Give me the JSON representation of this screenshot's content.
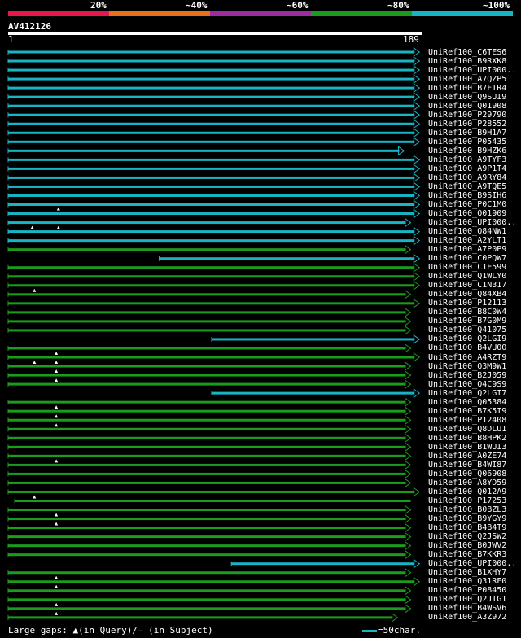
{
  "legend": {
    "labels": [
      "20%",
      "~40%",
      "~60%",
      "~80%",
      "~100%"
    ],
    "colors": [
      "#e8174c",
      "#e8701c",
      "#9c2ca0",
      "#1c9c1c",
      "#18b4c4"
    ]
  },
  "query": {
    "name": "AV412126",
    "start": "1",
    "end": "189"
  },
  "hits": [
    {
      "name": "UniRef100_C6TES6",
      "color": "#18b4c4",
      "start": 1,
      "end": 189,
      "arrow": true,
      "marks": []
    },
    {
      "name": "UniRef100_B9RXK8",
      "color": "#18b4c4",
      "start": 1,
      "end": 189,
      "arrow": true,
      "marks": []
    },
    {
      "name": "UniRef100_UPI000..",
      "color": "#18b4c4",
      "start": 1,
      "end": 189,
      "arrow": true,
      "marks": []
    },
    {
      "name": "UniRef100_A7QZP5",
      "color": "#18b4c4",
      "start": 1,
      "end": 189,
      "arrow": true,
      "marks": []
    },
    {
      "name": "UniRef100_B7FIR4",
      "color": "#18b4c4",
      "start": 1,
      "end": 189,
      "arrow": true,
      "marks": []
    },
    {
      "name": "UniRef100_Q9SUI9",
      "color": "#18b4c4",
      "start": 1,
      "end": 189,
      "arrow": true,
      "marks": []
    },
    {
      "name": "UniRef100_Q01908",
      "color": "#18b4c4",
      "start": 1,
      "end": 189,
      "arrow": true,
      "marks": []
    },
    {
      "name": "UniRef100_P29790",
      "color": "#18b4c4",
      "start": 1,
      "end": 189,
      "arrow": true,
      "marks": []
    },
    {
      "name": "UniRef100_P28552",
      "color": "#18b4c4",
      "start": 1,
      "end": 189,
      "arrow": true,
      "marks": []
    },
    {
      "name": "UniRef100_B9H1A7",
      "color": "#18b4c4",
      "start": 1,
      "end": 189,
      "arrow": true,
      "marks": []
    },
    {
      "name": "UniRef100_P05435",
      "color": "#18b4c4",
      "start": 1,
      "end": 189,
      "arrow": true,
      "marks": []
    },
    {
      "name": "UniRef100_B9HZK6",
      "color": "#18b4c4",
      "start": 1,
      "end": 182,
      "arrow": true,
      "marks": []
    },
    {
      "name": "UniRef100_A9TYF3",
      "color": "#18b4c4",
      "start": 1,
      "end": 189,
      "arrow": true,
      "marks": []
    },
    {
      "name": "UniRef100_A9P1T4",
      "color": "#18b4c4",
      "start": 1,
      "end": 189,
      "arrow": true,
      "marks": []
    },
    {
      "name": "UniRef100_A9RY84",
      "color": "#18b4c4",
      "start": 1,
      "end": 189,
      "arrow": true,
      "marks": []
    },
    {
      "name": "UniRef100_A9TQE5",
      "color": "#18b4c4",
      "start": 1,
      "end": 189,
      "arrow": true,
      "marks": []
    },
    {
      "name": "UniRef100_B9SIH6",
      "color": "#18b4c4",
      "start": 1,
      "end": 189,
      "arrow": true,
      "marks": []
    },
    {
      "name": "UniRef100_P0C1M0",
      "color": "#18b4c4",
      "start": 1,
      "end": 189,
      "arrow": true,
      "marks": []
    },
    {
      "name": "UniRef100_Q01909",
      "color": "#18b4c4",
      "start": 1,
      "end": 189,
      "arrow": true,
      "marks": [
        {
          "pos": 24,
          "row": "above"
        }
      ]
    },
    {
      "name": "UniRef100_UPI000..",
      "color": "#18b4c4",
      "start": 1,
      "end": 185,
      "arrow": true,
      "marks": [
        {
          "pos": 12,
          "row": "below"
        },
        {
          "pos": 24,
          "row": "below"
        }
      ]
    },
    {
      "name": "UniRef100_Q84NW1",
      "color": "#18b4c4",
      "start": 1,
      "end": 189,
      "arrow": true,
      "marks": []
    },
    {
      "name": "UniRef100_A2YLT1",
      "color": "#18b4c4",
      "start": 1,
      "end": 189,
      "arrow": true,
      "marks": []
    },
    {
      "name": "UniRef100_A7P0P9",
      "color": "#1c9c1c",
      "start": 1,
      "end": 185,
      "arrow": true,
      "marks": []
    },
    {
      "name": "UniRef100_C0PQW7",
      "color": "#18b4c4",
      "start": 70,
      "end": 189,
      "arrow": true,
      "marks": []
    },
    {
      "name": "UniRef100_C1E599",
      "color": "#1c9c1c",
      "start": 1,
      "end": 189,
      "arrow": true,
      "marks": []
    },
    {
      "name": "UniRef100_Q1WLY0",
      "color": "#1c9c1c",
      "start": 1,
      "end": 189,
      "arrow": true,
      "marks": []
    },
    {
      "name": "UniRef100_C1N317",
      "color": "#1c9c1c",
      "start": 1,
      "end": 189,
      "arrow": true,
      "marks": [
        {
          "pos": 13,
          "row": "below"
        }
      ]
    },
    {
      "name": "UniRef100_Q84XB4",
      "color": "#1c9c1c",
      "start": 1,
      "end": 185,
      "arrow": true,
      "marks": []
    },
    {
      "name": "UniRef100_P12113",
      "color": "#1c9c1c",
      "start": 1,
      "end": 189,
      "arrow": true,
      "marks": []
    },
    {
      "name": "UniRef100_B8C0W4",
      "color": "#1c9c1c",
      "start": 1,
      "end": 185,
      "arrow": true,
      "marks": []
    },
    {
      "name": "UniRef100_B7G0M9",
      "color": "#1c9c1c",
      "start": 1,
      "end": 185,
      "arrow": true,
      "marks": []
    },
    {
      "name": "UniRef100_Q41075",
      "color": "#1c9c1c",
      "start": 1,
      "end": 185,
      "arrow": true,
      "marks": []
    },
    {
      "name": "UniRef100_Q2LGI9",
      "color": "#18b4c4",
      "start": 94,
      "end": 189,
      "arrow": true,
      "marks": []
    },
    {
      "name": "UniRef100_B4VU00",
      "color": "#1c9c1c",
      "start": 1,
      "end": 185,
      "arrow": true,
      "marks": [
        {
          "pos": 23,
          "row": "below"
        }
      ]
    },
    {
      "name": "UniRef100_A4RZT9",
      "color": "#1c9c1c",
      "start": 1,
      "end": 189,
      "arrow": true,
      "marks": [
        {
          "pos": 13,
          "row": "below"
        },
        {
          "pos": 23,
          "row": "below"
        }
      ]
    },
    {
      "name": "UniRef100_Q3M9W1",
      "color": "#1c9c1c",
      "start": 1,
      "end": 185,
      "arrow": true,
      "marks": [
        {
          "pos": 23,
          "row": "below"
        }
      ]
    },
    {
      "name": "UniRef100_B2J059",
      "color": "#1c9c1c",
      "start": 1,
      "end": 185,
      "arrow": true,
      "marks": [
        {
          "pos": 23,
          "row": "below"
        }
      ]
    },
    {
      "name": "UniRef100_Q4C9S9",
      "color": "#1c9c1c",
      "start": 1,
      "end": 185,
      "arrow": true,
      "marks": []
    },
    {
      "name": "UniRef100_Q2LGI7",
      "color": "#18b4c4",
      "start": 94,
      "end": 189,
      "arrow": true,
      "marks": []
    },
    {
      "name": "UniRef100_Q05384",
      "color": "#1c9c1c",
      "start": 1,
      "end": 185,
      "arrow": true,
      "marks": [
        {
          "pos": 23,
          "row": "below"
        }
      ]
    },
    {
      "name": "UniRef100_B7K5I9",
      "color": "#1c9c1c",
      "start": 1,
      "end": 185,
      "arrow": true,
      "marks": [
        {
          "pos": 23,
          "row": "below"
        }
      ]
    },
    {
      "name": "UniRef100_P12408",
      "color": "#1c9c1c",
      "start": 1,
      "end": 185,
      "arrow": true,
      "marks": [
        {
          "pos": 23,
          "row": "below"
        }
      ]
    },
    {
      "name": "UniRef100_Q8DLU1",
      "color": "#1c9c1c",
      "start": 1,
      "end": 185,
      "arrow": true,
      "marks": []
    },
    {
      "name": "UniRef100_B8HPK2",
      "color": "#1c9c1c",
      "start": 1,
      "end": 185,
      "arrow": true,
      "marks": []
    },
    {
      "name": "UniRef100_B1WUI3",
      "color": "#1c9c1c",
      "start": 1,
      "end": 185,
      "arrow": true,
      "marks": []
    },
    {
      "name": "UniRef100_A0ZE74",
      "color": "#1c9c1c",
      "start": 1,
      "end": 185,
      "arrow": true,
      "marks": [
        {
          "pos": 23,
          "row": "below"
        }
      ]
    },
    {
      "name": "UniRef100_B4WI87",
      "color": "#1c9c1c",
      "start": 1,
      "end": 185,
      "arrow": true,
      "marks": []
    },
    {
      "name": "UniRef100_Q06908",
      "color": "#1c9c1c",
      "start": 1,
      "end": 185,
      "arrow": true,
      "marks": []
    },
    {
      "name": "UniRef100_A8YD59",
      "color": "#1c9c1c",
      "start": 1,
      "end": 185,
      "arrow": true,
      "marks": []
    },
    {
      "name": "UniRef100_Q012A9",
      "color": "#1c9c1c",
      "start": 1,
      "end": 189,
      "arrow": true,
      "marks": [
        {
          "pos": 13,
          "row": "below"
        }
      ]
    },
    {
      "name": "UniRef100_P17253",
      "color": "#1c9c1c",
      "start": 4,
      "end": 185,
      "arrow": false,
      "marks": []
    },
    {
      "name": "UniRef100_B0BZL3",
      "color": "#1c9c1c",
      "start": 1,
      "end": 185,
      "arrow": true,
      "marks": [
        {
          "pos": 23,
          "row": "below"
        }
      ]
    },
    {
      "name": "UniRef100_B9YGY9",
      "color": "#1c9c1c",
      "start": 1,
      "end": 185,
      "arrow": true,
      "marks": [
        {
          "pos": 23,
          "row": "below"
        }
      ]
    },
    {
      "name": "UniRef100_B4B4T9",
      "color": "#1c9c1c",
      "start": 1,
      "end": 185,
      "arrow": true,
      "marks": []
    },
    {
      "name": "UniRef100_Q2JSW2",
      "color": "#1c9c1c",
      "start": 1,
      "end": 185,
      "arrow": true,
      "marks": []
    },
    {
      "name": "UniRef100_B0JWV2",
      "color": "#1c9c1c",
      "start": 1,
      "end": 185,
      "arrow": true,
      "marks": []
    },
    {
      "name": "UniRef100_B7KKR3",
      "color": "#1c9c1c",
      "start": 1,
      "end": 185,
      "arrow": true,
      "marks": []
    },
    {
      "name": "UniRef100_UPI000..",
      "color": "#18b4c4",
      "start": 103,
      "end": 189,
      "arrow": true,
      "marks": []
    },
    {
      "name": "UniRef100_B1XHY7",
      "color": "#1c9c1c",
      "start": 1,
      "end": 185,
      "arrow": true,
      "marks": [
        {
          "pos": 23,
          "row": "below"
        }
      ]
    },
    {
      "name": "UniRef100_Q31RF0",
      "color": "#1c9c1c",
      "start": 1,
      "end": 189,
      "arrow": true,
      "marks": [
        {
          "pos": 23,
          "row": "below"
        }
      ]
    },
    {
      "name": "UniRef100_P08450",
      "color": "#1c9c1c",
      "start": 1,
      "end": 185,
      "arrow": true,
      "marks": []
    },
    {
      "name": "UniRef100_Q2JIG1",
      "color": "#1c9c1c",
      "start": 1,
      "end": 185,
      "arrow": true,
      "marks": [
        {
          "pos": 23,
          "row": "below"
        }
      ]
    },
    {
      "name": "UniRef100_B4WSV6",
      "color": "#1c9c1c",
      "start": 1,
      "end": 185,
      "arrow": true,
      "marks": [
        {
          "pos": 23,
          "row": "below"
        }
      ]
    },
    {
      "name": "UniRef100_A3Z972",
      "color": "#1c9c1c",
      "start": 1,
      "end": 179,
      "arrow": true,
      "marks": []
    }
  ],
  "footer": {
    "text": "Large gaps: ▲(in Query)/‒ (in Subject)",
    "scale_text": "=50char."
  }
}
